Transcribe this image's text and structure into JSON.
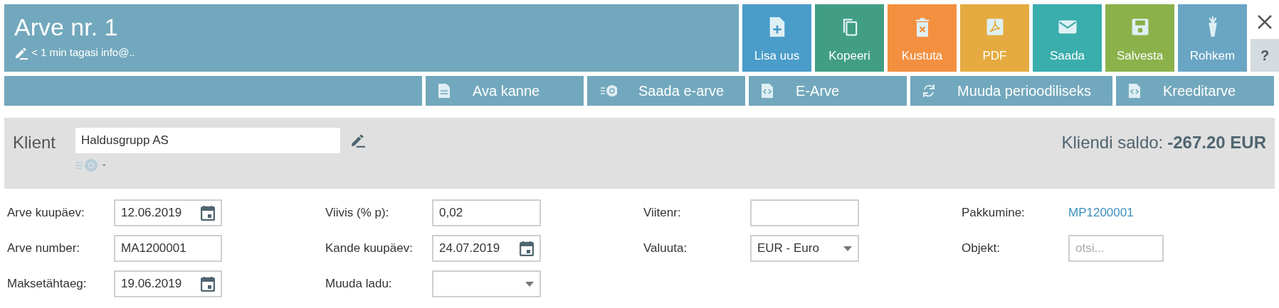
{
  "header": {
    "title": "Arve nr. 1",
    "subtitle": "< 1 min tagasi info@.."
  },
  "actions": [
    {
      "label": "Lisa uus",
      "kind": "add",
      "color": "#4a9cc9"
    },
    {
      "label": "Kopeeri",
      "kind": "copy",
      "color": "#419e83"
    },
    {
      "label": "Kustuta",
      "kind": "delete",
      "color": "#f39040"
    },
    {
      "label": "PDF",
      "kind": "pdf",
      "color": "#e5ab40"
    },
    {
      "label": "Saada",
      "kind": "mail",
      "color": "#3aadad"
    },
    {
      "label": "Salvesta",
      "kind": "save",
      "color": "#8bb14a"
    },
    {
      "label": "Rohkem",
      "kind": "more",
      "color": "#6aa5c4"
    }
  ],
  "help": "?",
  "toolbar": [
    {
      "label": "Ava kanne",
      "kind": "doc"
    },
    {
      "label": "Saada e-arve",
      "kind": "email"
    },
    {
      "label": "E-Arve",
      "kind": "code"
    },
    {
      "label": "Muuda perioodiliseks",
      "kind": "refresh"
    },
    {
      "label": "Kreeditarve",
      "kind": "code"
    }
  ],
  "client": {
    "label": "Klient",
    "value": "Haldusgrupp AS",
    "email": "-",
    "balance_label": "Kliendi saldo:",
    "balance": "-267.20 EUR"
  },
  "form_columns": [
    [
      {
        "label": "Arve kuupäev:",
        "kind": "date",
        "value": "12.06.2019"
      },
      {
        "label": "Arve number:",
        "kind": "text",
        "value": "MA1200001"
      },
      {
        "label": "Maksetähtaeg:",
        "kind": "date",
        "value": "19.06.2019"
      }
    ],
    [
      {
        "label": "Viivis (% p):",
        "kind": "text",
        "value": "0,02"
      },
      {
        "label": "Kande kuupäev:",
        "kind": "date",
        "value": "24.07.2019"
      },
      {
        "label": "Muuda ladu:",
        "kind": "select"
      }
    ],
    [
      {
        "label": "Viitenr:",
        "kind": "text"
      },
      {
        "label": "Valuuta:",
        "kind": "select",
        "value": "EUR - Euro"
      }
    ],
    [
      {
        "label": "Pakkumine:",
        "kind": "link",
        "value": "MP1200001"
      },
      {
        "label": "Objekt:",
        "kind": "search",
        "placeholder": "otsi..."
      }
    ]
  ]
}
